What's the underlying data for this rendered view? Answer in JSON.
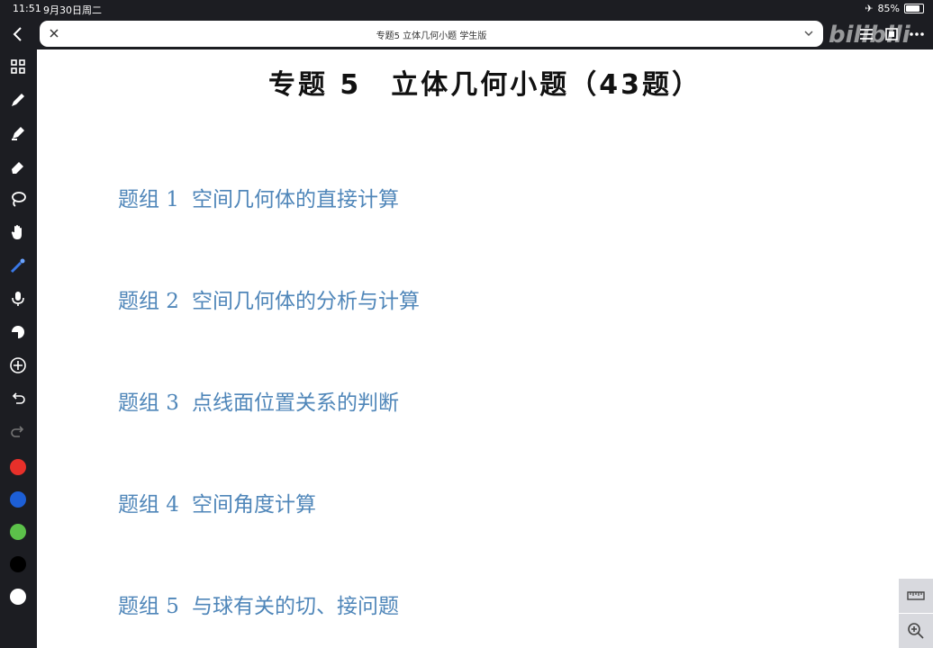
{
  "status_bar": {
    "time": "11:51",
    "date": "9月30日周二",
    "battery_percent": "85%",
    "battery_level": 0.85
  },
  "tab": {
    "title": "专题5 立体几何小题 学生版"
  },
  "watermark": "bilibili",
  "document": {
    "title": "专题 5　立体几何小题（43题）",
    "groups": [
      {
        "label": "题组 1",
        "text": "空间几何体的直接计算"
      },
      {
        "label": "题组 2",
        "text": "空间几何体的分析与计算"
      },
      {
        "label": "题组 3",
        "text": "点线面位置关系的判断"
      },
      {
        "label": "题组 4",
        "text": "空间角度计算"
      },
      {
        "label": "题组 5",
        "text": "与球有关的切、接问题"
      }
    ]
  },
  "toolbar": {
    "tools": [
      "back-icon",
      "grid-icon",
      "pen-icon",
      "highlighter-icon",
      "eraser-icon",
      "lasso-icon",
      "hand-icon",
      "laser-pointer-icon",
      "microphone-icon",
      "sticker-icon",
      "add-icon",
      "undo-icon",
      "redo-icon"
    ],
    "colors": [
      "#e8302a",
      "#1d5fd6",
      "#5cc14a",
      "#000000",
      "#ffffff"
    ]
  },
  "colors": {
    "background": "#1c1d22",
    "group_text": "#4f86b9",
    "title_text": "#111111"
  }
}
